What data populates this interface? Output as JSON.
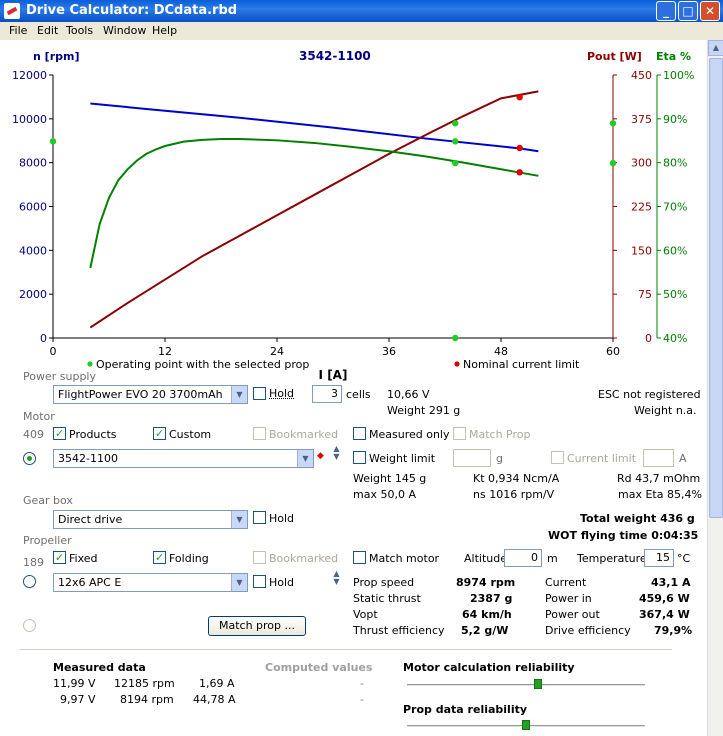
{
  "window": {
    "title": "Drive Calculator: DCdata.rbd"
  },
  "menu": [
    "File",
    "Edit",
    "Tools",
    "Window",
    "Help"
  ],
  "chart_data": {
    "type": "line",
    "title": "3542-1100",
    "xlabel": "I [A]",
    "xlim": [
      0,
      60
    ],
    "x_ticks": [
      "0",
      "12",
      "24",
      "36",
      "48",
      "60"
    ],
    "left_axis": {
      "label": "n [rpm]",
      "lim": [
        0,
        12000
      ],
      "ticks": [
        "0",
        "2000",
        "4000",
        "6000",
        "8000",
        "10000",
        "12000"
      ],
      "color": "#000080"
    },
    "right_axis_1": {
      "label": "Pout [W]",
      "lim": [
        0,
        450
      ],
      "ticks": [
        "0",
        "75",
        "150",
        "225",
        "300",
        "375",
        "450"
      ],
      "color": "#8b0000"
    },
    "right_axis_2": {
      "label": "Eta %",
      "lim": [
        40,
        100
      ],
      "ticks": [
        "40%",
        "50%",
        "60%",
        "70%",
        "80%",
        "90%",
        "100%"
      ],
      "color": "#008000"
    },
    "series": [
      {
        "axis": "left",
        "color": "#0000cc",
        "x": [
          4,
          10,
          20,
          30,
          40,
          50,
          52
        ],
        "y": [
          10700,
          10450,
          10050,
          9600,
          9100,
          8650,
          8520
        ]
      },
      {
        "axis": "right_1",
        "color": "#8b0000",
        "x": [
          4,
          8,
          12,
          16,
          20,
          24,
          28,
          32,
          36,
          40,
          44,
          48,
          52
        ],
        "y": [
          18,
          60,
          100,
          140,
          175,
          210,
          245,
          280,
          315,
          348,
          380,
          410,
          422
        ]
      },
      {
        "axis": "right_2",
        "color": "#008000",
        "x": [
          4,
          5,
          6,
          7,
          8,
          9,
          10,
          11,
          12,
          14,
          16,
          18,
          20,
          24,
          28,
          32,
          36,
          40,
          44,
          48,
          52
        ],
        "y": [
          56,
          66,
          72,
          76,
          78.5,
          80.5,
          82,
          83,
          83.8,
          84.8,
          85.2,
          85.4,
          85.4,
          85.1,
          84.5,
          83.6,
          82.6,
          81.4,
          80,
          78.5,
          77
        ]
      }
    ],
    "markers": [
      {
        "axis": "right_1",
        "x": 50,
        "y": 412,
        "color": "#e00000"
      },
      {
        "axis": "left",
        "x": 50,
        "y": 8670,
        "color": "#e00000"
      },
      {
        "axis": "right_2",
        "x": 50,
        "y": 77.8,
        "color": "#e00000"
      },
      {
        "axis": "left",
        "x": 43.1,
        "y": 8974,
        "color": "#22cc22"
      },
      {
        "axis": "right_1",
        "x": 43.1,
        "y": 367.4,
        "color": "#22cc22"
      },
      {
        "axis": "right_2",
        "x": 43.1,
        "y": 79.9,
        "color": "#22cc22"
      },
      {
        "axis": "right_2",
        "x": 43.1,
        "y": 40,
        "color": "#22cc22"
      },
      {
        "axis": "left",
        "x": 0,
        "y": 8974,
        "color": "#22cc22"
      },
      {
        "axis": "right_1",
        "x": 60,
        "y": 367.4,
        "color": "#22cc22"
      },
      {
        "axis": "right_2",
        "x": 60,
        "y": 79.9,
        "color": "#22cc22"
      }
    ],
    "legend": [
      "Operating point  with the selected prop",
      "Nominal current limit"
    ],
    "legend_colors": [
      "#22cc22",
      "#e00000"
    ]
  },
  "power_supply": {
    "section": "Power supply",
    "battery": "FlightPower EVO 20 3700mAh",
    "hold": "Hold",
    "cells_value": "3",
    "cells_label": "cells",
    "voltage": "10,66 V",
    "weight": "Weight 291 g",
    "esc": "ESC  not registered",
    "esc_weight": "Weight n.a."
  },
  "motor": {
    "section": "Motor",
    "count": "409",
    "products": "Products",
    "custom": "Custom",
    "bookmarked": "Bookmarked",
    "measured_only": "Measured only",
    "match_prop": "Match Prop",
    "name": "3542-1100",
    "weight_limit": "Weight limit",
    "weight_unit": "g",
    "current_limit": "Current limit",
    "current_unit": "A",
    "weight": "Weight 145 g",
    "kt": "Kt 0,934 Ncm/A",
    "rd": "Rd 43,7 mOhm",
    "max_i": "max 50,0 A",
    "ns": "ns 1016 rpm/V",
    "max_eta": "max Eta 85,4%"
  },
  "gearbox": {
    "section": "Gear box",
    "value": "Direct drive",
    "hold": "Hold",
    "total_weight": "Total weight 436 g",
    "wot": "WOT flying time 0:04:35"
  },
  "propeller": {
    "section": "Propeller",
    "count": "189",
    "fixed": "Fixed",
    "folding": "Folding",
    "bookmarked": "Bookmarked",
    "match_motor": "Match motor",
    "altitude_label": "Altitude",
    "altitude_value": "0",
    "altitude_unit": "m",
    "temp_label": "Temperature",
    "temp_value": "15",
    "temp_unit": "°C",
    "name": "12x6 APC E",
    "hold": "Hold",
    "match_prop_btn": "Match prop ..."
  },
  "results": {
    "prop_speed_l": "Prop speed",
    "prop_speed_v": "8974 rpm",
    "static_thrust_l": "Static thrust",
    "static_thrust_v": "2387 g",
    "vopt_l": "Vopt",
    "vopt_v": "64 km/h",
    "thrust_eff_l": "Thrust efficiency",
    "thrust_eff_v": "5,2 g/W",
    "current_l": "Current",
    "current_v": "43,1 A",
    "power_in_l": "Power in",
    "power_in_v": "459,6 W",
    "power_out_l": "Power out",
    "power_out_v": "367,4 W",
    "drive_eff_l": "Drive efficiency",
    "drive_eff_v": "79,9%"
  },
  "measured": {
    "title": "Measured data",
    "rows": [
      [
        "11,99 V",
        "12185 rpm",
        "1,69 A"
      ],
      [
        "9,97 V",
        "8194 rpm",
        "44,78 A"
      ]
    ],
    "computed_title": "Computed values",
    "computed_rows": [
      "-",
      "-"
    ],
    "motor_rel": "Motor calculation reliability",
    "motor_rel_level": 0.55,
    "prop_rel": "Prop data reliability",
    "prop_rel_level": 0.5
  },
  "colors": {
    "accent": "#21a121",
    "title_bar": "#0a5fd8"
  }
}
